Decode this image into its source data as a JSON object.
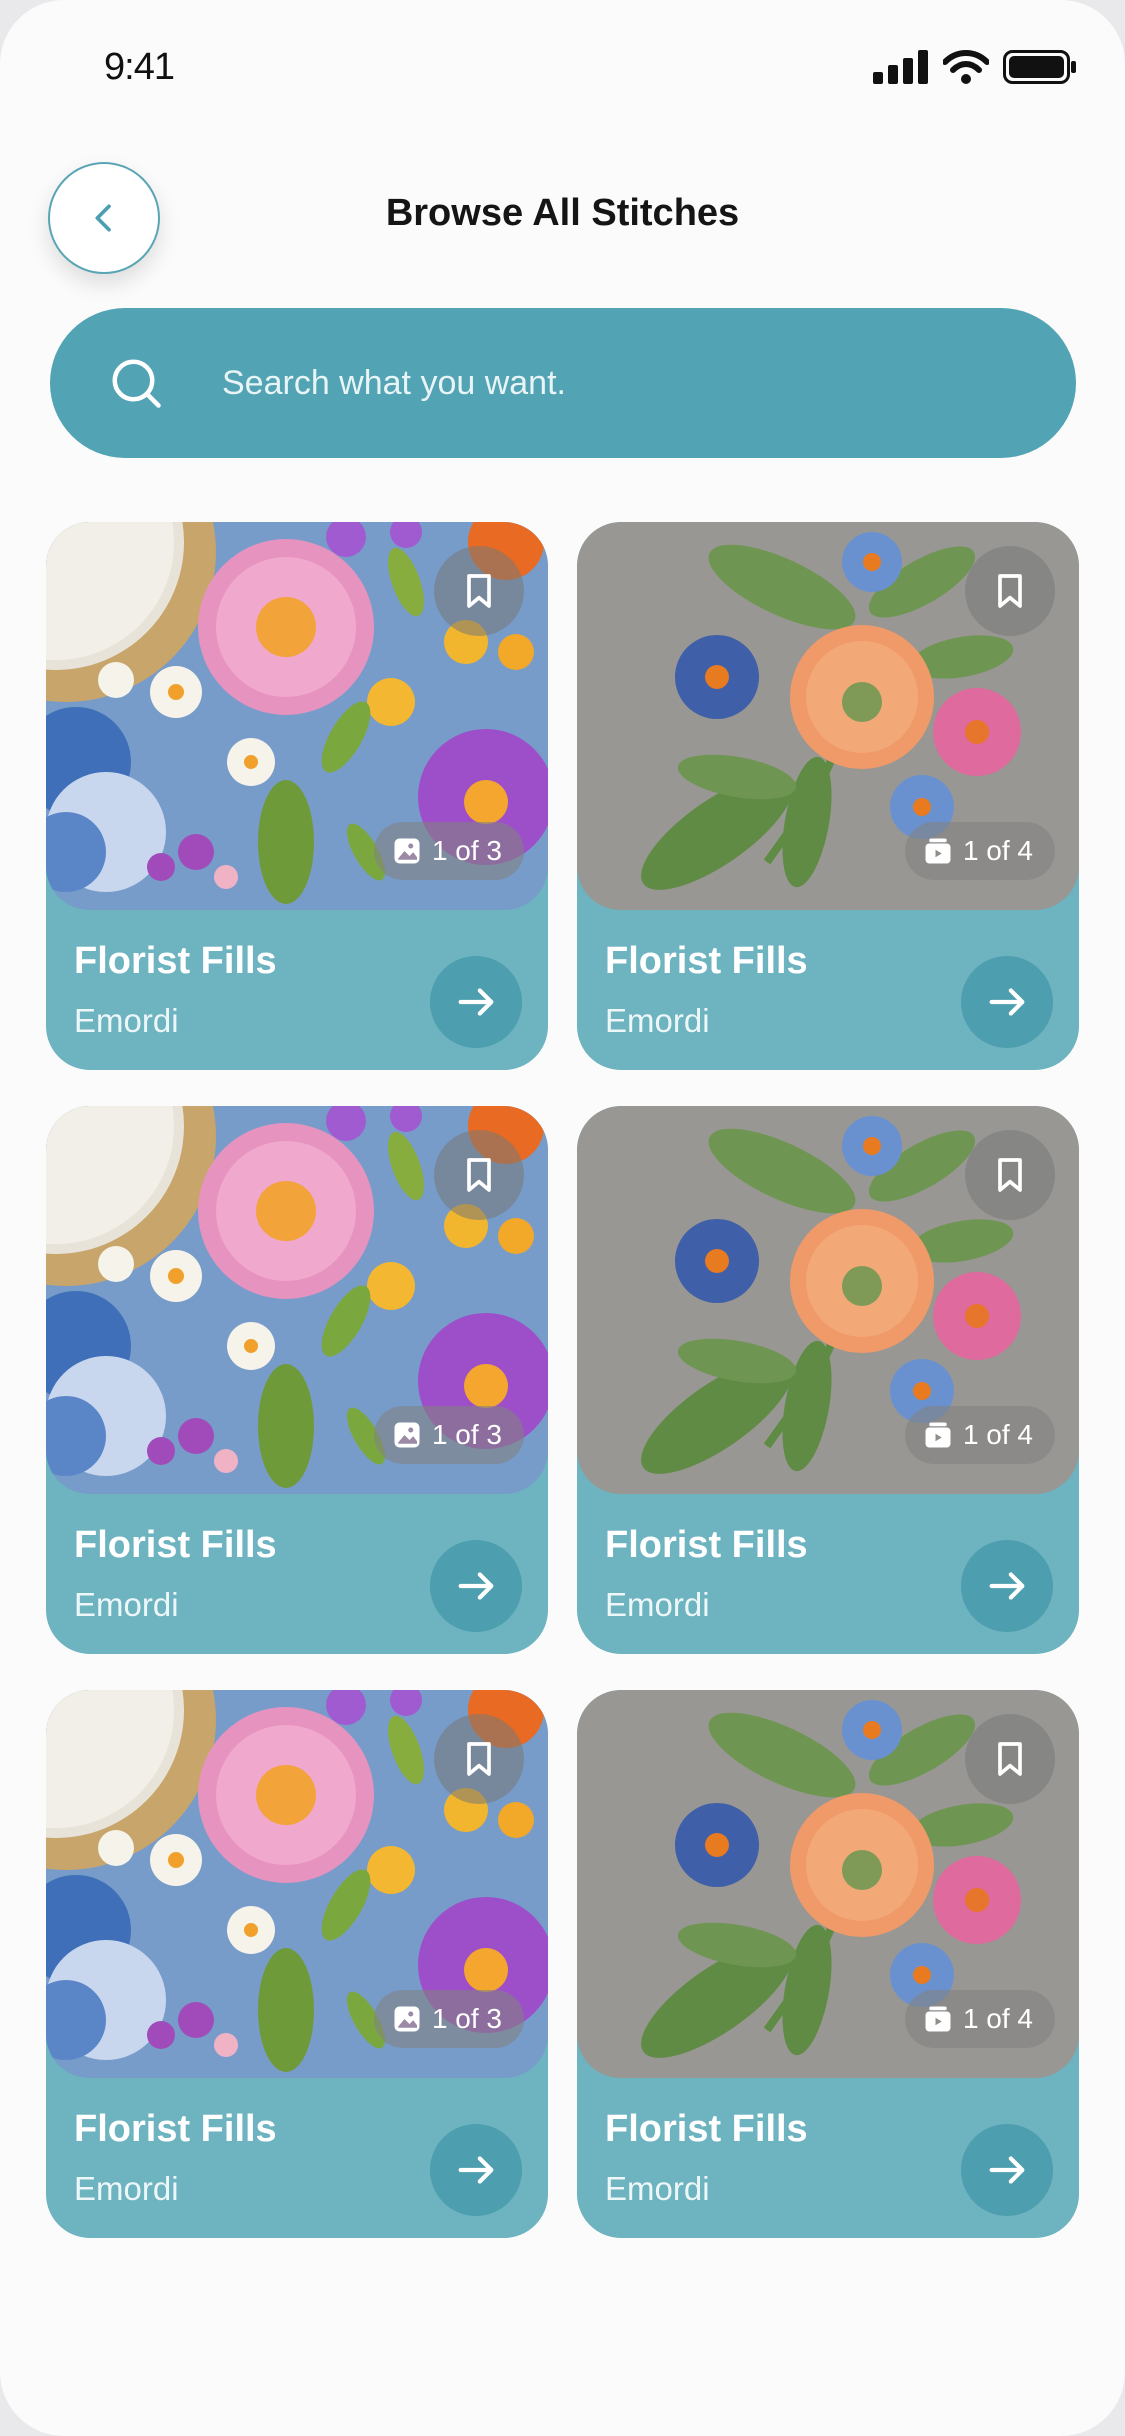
{
  "status_bar": {
    "time": "9:41"
  },
  "header": {
    "title": "Browse All Stitches"
  },
  "search": {
    "placeholder": "Search what you want."
  },
  "cards": [
    {
      "title": "Florist Fills",
      "subtitle": "Emordi",
      "counter": "1 of 3",
      "image": "embroidery-pink-flowers-denim"
    },
    {
      "title": "Florist Fills",
      "subtitle": "Emordi",
      "counter": "1 of 4",
      "image": "embroidery-orange-flower-linen"
    },
    {
      "title": "Florist Fills",
      "subtitle": "Emordi",
      "counter": "1 of 3",
      "image": "embroidery-pink-flowers-denim"
    },
    {
      "title": "Florist Fills",
      "subtitle": "Emordi",
      "counter": "1 of 4",
      "image": "embroidery-orange-flower-linen"
    },
    {
      "title": "Florist Fills",
      "subtitle": "Emordi",
      "counter": "1 of 3",
      "image": "embroidery-pink-flowers-denim"
    },
    {
      "title": "Florist Fills",
      "subtitle": "Emordi",
      "counter": "1 of 4",
      "image": "embroidery-orange-flower-linen"
    }
  ],
  "icons": {
    "back": "chevron-left-icon",
    "search": "search-icon",
    "bookmark": "bookmark-icon",
    "image_counter": "image-icon",
    "gallery_counter": "gallery-icon",
    "go": "arrow-right-icon"
  },
  "colors": {
    "accent": "#52a3b4",
    "card": "#6db3c0",
    "card_button": "#4d9eae",
    "background": "#fbfbfb"
  }
}
